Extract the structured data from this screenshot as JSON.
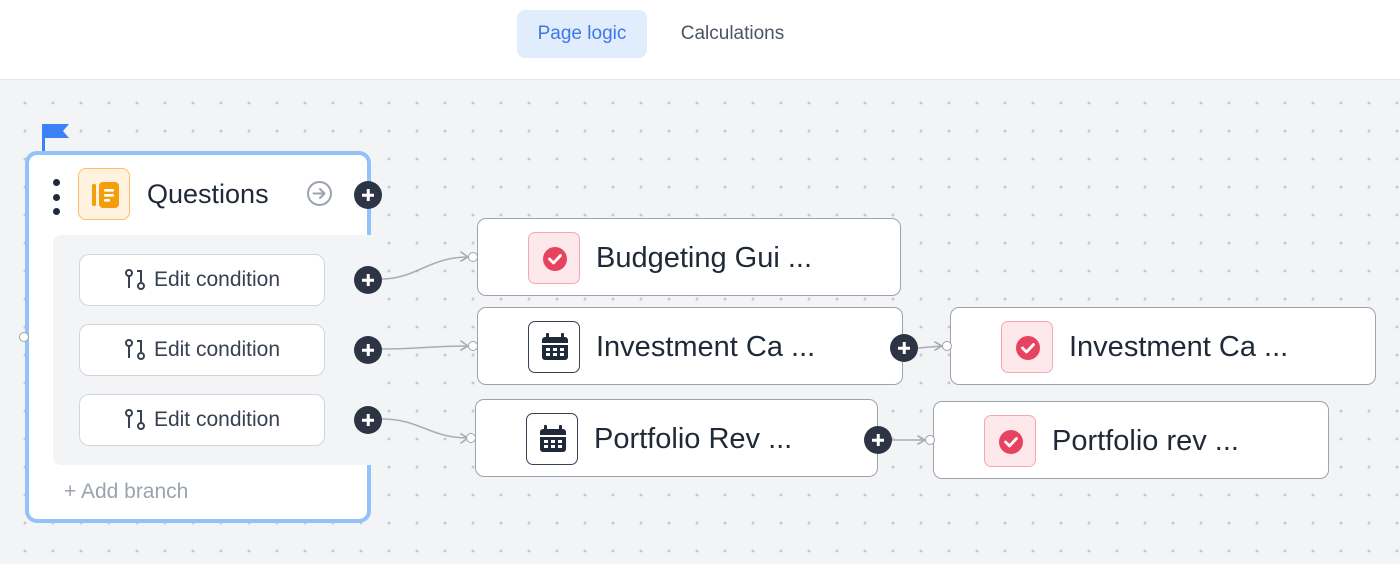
{
  "tabs": [
    {
      "label": "Page logic",
      "active": true
    },
    {
      "label": "Calculations",
      "active": false
    }
  ],
  "questions_node": {
    "title": "Questions",
    "icon": "document-list-icon",
    "conditions": [
      {
        "label": "Edit condition"
      },
      {
        "label": "Edit condition"
      },
      {
        "label": "Edit condition"
      }
    ],
    "add_branch": "+ Add branch"
  },
  "cards": [
    {
      "label": "Budgeting Gui ...",
      "icon": "check-circle-icon"
    },
    {
      "label": "Investment Ca ...",
      "icon": "calendar-icon"
    },
    {
      "label": "Investment Ca ...",
      "icon": "check-circle-icon"
    },
    {
      "label": "Portfolio Rev ...",
      "icon": "calendar-icon"
    },
    {
      "label": "Portfolio rev ...",
      "icon": "check-circle-icon"
    }
  ],
  "colors": {
    "accent_blue": "#3b7ae6",
    "node_border": "#93c2fb",
    "check_red": "#e8435e",
    "plus_dark": "#2d3544"
  }
}
